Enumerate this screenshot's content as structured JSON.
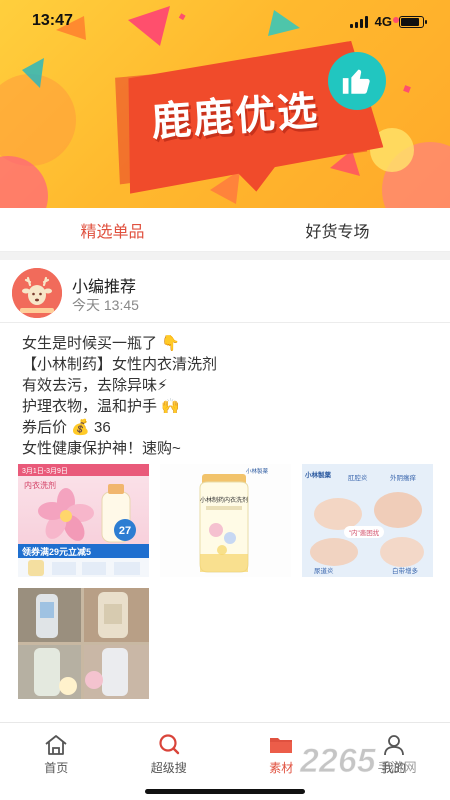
{
  "status_bar": {
    "time": "13:47",
    "network": "4G",
    "battery_level": 0.85
  },
  "banner": {
    "title": "鹿鹿优选",
    "icon": "thumbs-up-icon",
    "colors": {
      "background": "#ffbf33",
      "burst": "#f04b2b",
      "bubble": "#21c6c0"
    }
  },
  "tabs": [
    {
      "label": "精选单品",
      "active": true
    },
    {
      "label": "好货专场",
      "active": false
    }
  ],
  "post": {
    "author": "小编推荐",
    "time": "今天 13:45",
    "lines": [
      {
        "text": "女生是时候买一瓶了",
        "emoji": "👇"
      },
      {
        "text": "【小林制药】女性内衣清洗剂",
        "emoji": ""
      },
      {
        "text": "有效去污，去除异味",
        "emoji": "⚡"
      },
      {
        "text": "护理衣物，温和护手",
        "emoji": "🙌"
      },
      {
        "text": "券后价",
        "emoji": "💰",
        "suffix": "36"
      },
      {
        "text": "女性健康保护神！速购~",
        "emoji": ""
      }
    ],
    "images": [
      {
        "name": "product-image-1",
        "texts": {
          "tag": "3月1日-3月9日",
          "label": "内衣洗剂",
          "badge": "27",
          "coupon": "领券满29元立减5"
        }
      },
      {
        "name": "product-image-2",
        "texts": {
          "brand": "小林製薬",
          "product": "小林制药内衣洗剂"
        }
      },
      {
        "name": "product-image-3",
        "texts": {
          "brand": "小林製薬",
          "a": "肛腔炎",
          "b": "外阴瘙痒",
          "c": "\"内\"患困扰",
          "d": "尿道炎",
          "e": "白带增多"
        }
      },
      {
        "name": "product-image-4",
        "texts": {}
      }
    ]
  },
  "bottom_nav": [
    {
      "label": "首页",
      "icon": "home-icon",
      "active": false
    },
    {
      "label": "超级搜",
      "icon": "search-icon",
      "active": false
    },
    {
      "label": "素材",
      "icon": "folder-icon",
      "active": true
    },
    {
      "label": "我的",
      "icon": "person-icon",
      "active": false
    }
  ],
  "watermark": {
    "number": "2265",
    "text": "手游网"
  },
  "accent_color": "#e0513f"
}
